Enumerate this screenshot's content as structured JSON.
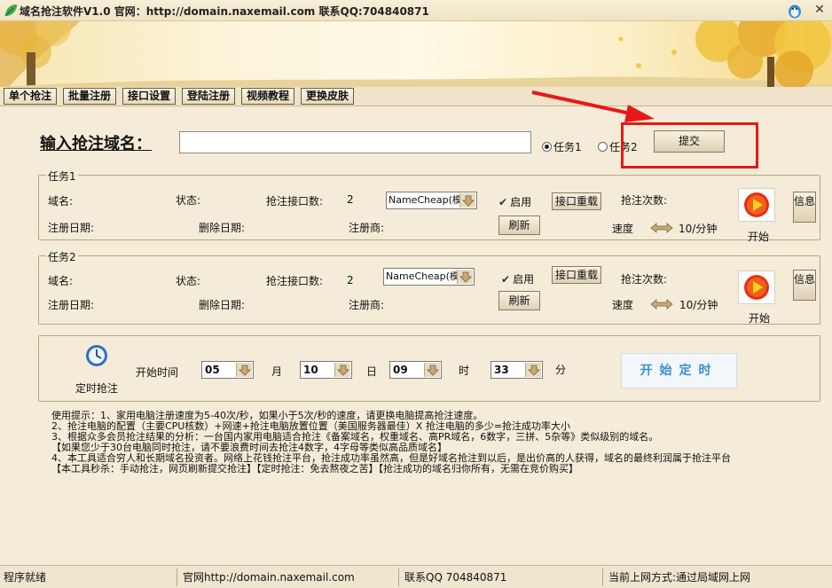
{
  "window": {
    "title": "域名抢注软件V1.0 官网：http://domain.naxemail.com 联系QQ:704840871",
    "close_label": "✕"
  },
  "menu": [
    "单个抢注",
    "批量注册",
    "接口设置",
    "登陆注册",
    "视频教程",
    "更换皮肤"
  ],
  "domain_entry": {
    "label": "输入抢注域名：",
    "value": "",
    "placeholder": "",
    "radio_task1": "任务1",
    "radio_task2": "任务2",
    "selected": "任务1",
    "submit_label": "提交"
  },
  "tasks": [
    {
      "legend": "任务1",
      "domain_label": "域名:",
      "status_label": "状态:",
      "api_count_label": "抢注接口数:",
      "api_count": "2",
      "api_select": "NameCheap(模拟",
      "enable_label": "启用",
      "reload_label": "接口重载",
      "attempts_label": "抢注次数:",
      "reg_date_label": "注册日期:",
      "del_date_label": "删除日期:",
      "registrar_label": "注册商:",
      "refresh_label": "刷新",
      "speed_label": "速度",
      "speed_value": "10/分钟",
      "start_label": "开始",
      "info_label": "信息"
    },
    {
      "legend": "任务2",
      "domain_label": "域名:",
      "status_label": "状态:",
      "api_count_label": "抢注接口数:",
      "api_count": "2",
      "api_select": "NameCheap(模拟",
      "enable_label": "启用",
      "reload_label": "接口重载",
      "attempts_label": "抢注次数:",
      "reg_date_label": "注册日期:",
      "del_date_label": "删除日期:",
      "registrar_label": "注册商:",
      "refresh_label": "刷新",
      "speed_label": "速度",
      "speed_value": "10/分钟",
      "start_label": "开始",
      "info_label": "信息"
    }
  ],
  "timer": {
    "icon_label": "定时抢注",
    "start_time_label": "开始时间",
    "month": "05",
    "month_unit": "月",
    "day": "10",
    "day_unit": "日",
    "hour": "09",
    "hour_unit": "时",
    "minute": "33",
    "minute_unit": "分",
    "start_button": "开始定时"
  },
  "tips": [
    "使用提示：1、家用电脑注册速度为5-40次/秒，如果小于5次/秒的速度，请更换电脑提高抢注速度。",
    "2、抢注电脑的配置（主要CPU核数）+网速+抢注电脑放置位置（美国服务器最佳）X 抢注电脑的多少=抢注成功率大小",
    "3、根据众多会员抢注结果的分析：一台国内家用电脑适合抢注《备案域名，权重域名、高PR域名，6数字，三拼、5杂等》类似级别的域名。",
    "【如果您少于30台电脑同时抢注，请不要浪费时间去抢注4数字，4字母等类似高品质域名】",
    "4、本工具适合穷人和长期域名投资者。网络上花钱抢注平台，抢注成功率虽然高，但是好域名抢注到以后，是出价高的人获得，域名的最终利润属于抢注平台",
    "【本工具秒杀：手动抢注，网页刷新提交抢注】【定时抢注：免去熬夜之苦】【抢注成功的域名归你所有，无需在竞价购买】"
  ],
  "status": {
    "ready": "程序就绪",
    "site": "官网http://domain.naxemail.com",
    "qq": "联系QQ 704840871",
    "network": "当前上网方式:通过局域网上网"
  },
  "colors": {
    "background": "#f4ecd8",
    "annotation": "#e81818",
    "start_timer_text": "#3a8fd0",
    "play_icon": "#e82a10"
  }
}
